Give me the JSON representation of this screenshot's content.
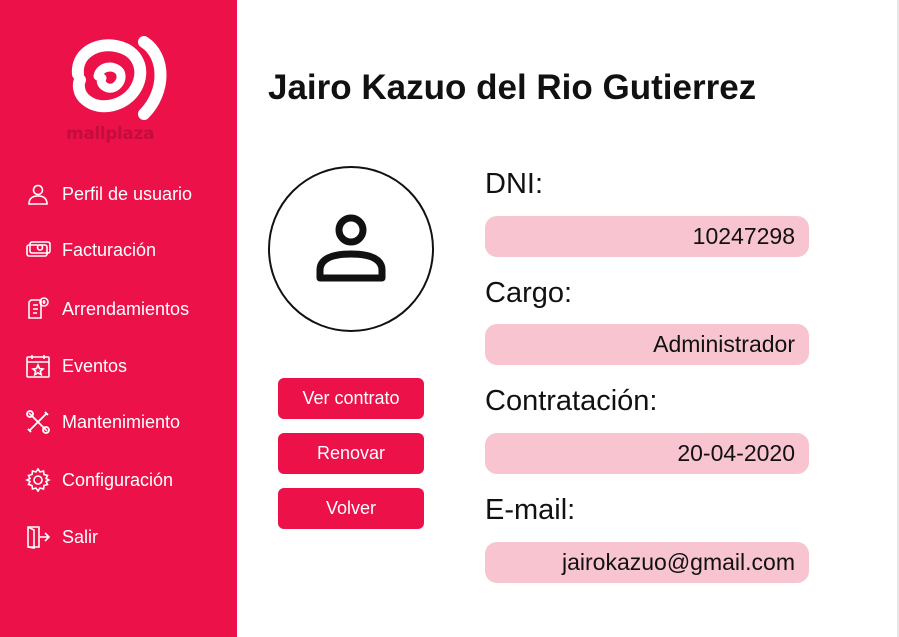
{
  "brand": {
    "name": "mallplaza",
    "accent_color": "#ec1249",
    "field_bg_color": "#f7c4d0"
  },
  "sidebar": {
    "items": [
      {
        "label": "Perfil de usuario",
        "icon": "user-icon"
      },
      {
        "label": "Facturación",
        "icon": "money-icon"
      },
      {
        "label": "Arrendamientos",
        "icon": "document-icon"
      },
      {
        "label": "Eventos",
        "icon": "calendar-icon"
      },
      {
        "label": "Mantenimiento",
        "icon": "tools-icon"
      },
      {
        "label": "Configuración",
        "icon": "gear-icon"
      },
      {
        "label": "Salir",
        "icon": "exit-icon"
      }
    ]
  },
  "profile": {
    "name": "Jairo Kazuo del Rio Gutierrez",
    "avatar_icon": "user-avatar-icon"
  },
  "actions": {
    "view_contract": "Ver contrato",
    "renew": "Renovar",
    "back": "Volver"
  },
  "fields": [
    {
      "label": "DNI:",
      "value": "10247298"
    },
    {
      "label": "Cargo:",
      "value": "Administrador"
    },
    {
      "label": "Contratación:",
      "value": "20-04-2020"
    },
    {
      "label": "E-mail:",
      "value": "jairokazuo@gmail.com"
    }
  ]
}
